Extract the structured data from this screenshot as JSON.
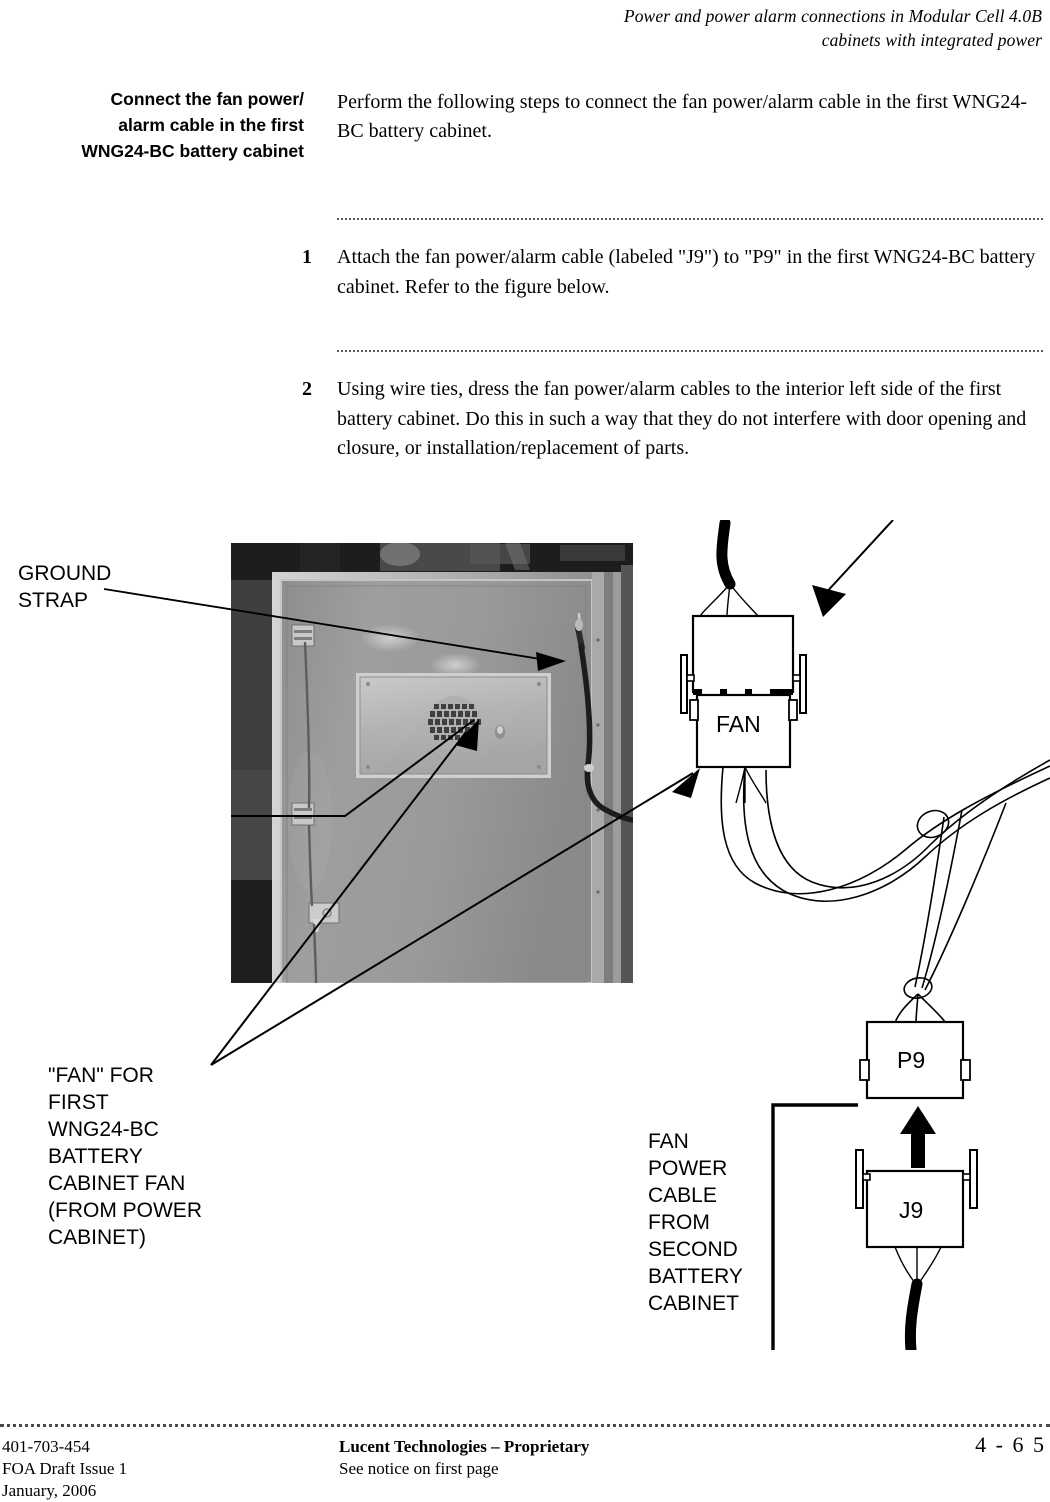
{
  "header": {
    "line1": "Power and power alarm connections in Modular Cell 4.0B",
    "line2": "cabinets with integrated power"
  },
  "section": {
    "side_heading_line1": "Connect the fan power/",
    "side_heading_line2": "alarm cable in the first",
    "side_heading_line3": "WNG24-BC battery cabinet",
    "intro": "Perform the following steps to connect the fan power/alarm cable in the first WNG24-BC battery cabinet."
  },
  "steps": [
    {
      "number": "1",
      "text": "Attach the fan power/alarm cable (labeled \"J9\") to \"P9\" in the first WNG24-BC battery cabinet. Refer to the figure below."
    },
    {
      "number": "2",
      "text": "Using wire ties, dress the fan power/alarm cables to the interior left side of the first battery cabinet. Do this in such a way that they do not interfere with door opening and closure, or installation/replacement of parts."
    }
  ],
  "figure": {
    "callouts": {
      "ground_strap": [
        "GROUND",
        "STRAP"
      ],
      "fan_first_cabinet": [
        "\"FAN\" FOR",
        "FIRST",
        "WNG24-BC",
        "BATTERY",
        "CABINET FAN",
        "(FROM POWER",
        "CABINET)"
      ],
      "fan_power_cable": [
        "FAN",
        "POWER",
        "CABLE",
        "FROM",
        "SECOND",
        "BATTERY",
        "CABINET"
      ]
    },
    "connectors": {
      "fan": "FAN",
      "p9": "P9",
      "j9": "J9"
    }
  },
  "footer": {
    "doc_number": "401-703-454",
    "issue": "FOA Draft Issue 1",
    "date": "January, 2006",
    "proprietary": "Lucent Technologies – Proprietary",
    "notice": "See notice on first page",
    "page": "4 -  6 5"
  }
}
